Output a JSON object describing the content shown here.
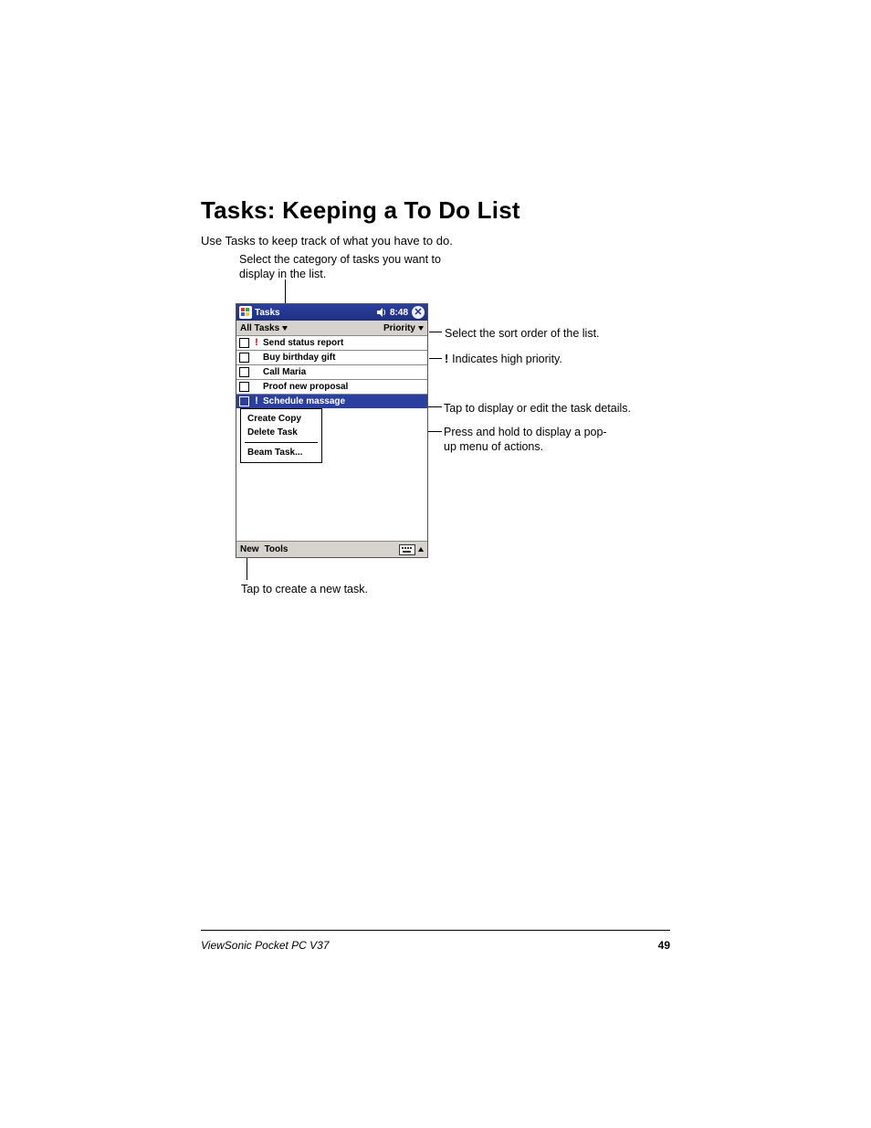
{
  "heading": "Tasks: Keeping a To Do List",
  "intro": "Use Tasks to keep track of what you have to do.",
  "callouts": {
    "top": "Select the category of tasks you want to display in the list.",
    "sort": "Select the sort order of the list.",
    "priority": "Indicates high priority.",
    "priority_mark": "!",
    "details": "Tap to display or edit the task details.",
    "hold": "Press and hold to display a pop-up menu of actions.",
    "newtask": "Tap to create a new task."
  },
  "device": {
    "titlebar": {
      "app": "Tasks",
      "time": "8:48"
    },
    "filter": {
      "category": "All Tasks",
      "sort": "Priority"
    },
    "tasks": [
      {
        "priority": true,
        "label": "Send status report",
        "selected": false
      },
      {
        "priority": false,
        "label": "Buy birthday gift",
        "selected": false
      },
      {
        "priority": false,
        "label": "Call Maria",
        "selected": false
      },
      {
        "priority": false,
        "label": "Proof new proposal",
        "selected": false
      },
      {
        "priority": true,
        "label": "Schedule massage",
        "selected": true
      }
    ],
    "context_menu": {
      "items": [
        "Create Copy",
        "Delete Task",
        "Beam Task..."
      ]
    },
    "menubar": {
      "new": "New",
      "tools": "Tools"
    }
  },
  "footer": {
    "left": "ViewSonic  Pocket PC  V37",
    "page": "49"
  }
}
